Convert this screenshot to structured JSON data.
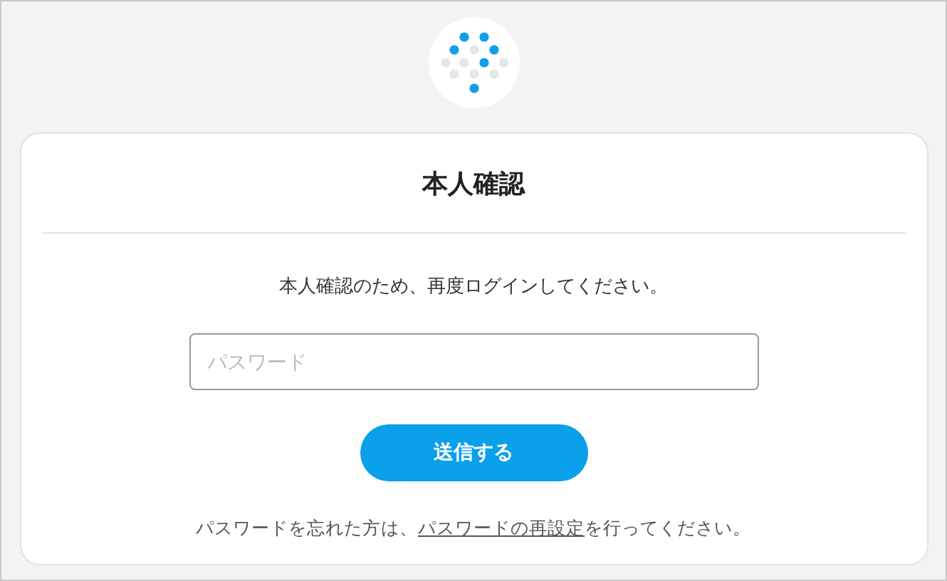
{
  "title": "本人確認",
  "message": "本人確認のため、再度ログインしてください。",
  "password_field": {
    "placeholder": "パスワード"
  },
  "submit_button": "送信する",
  "footer": {
    "before": "パスワードを忘れた方は、",
    "link": "パスワードの再設定",
    "after": "を行ってください。"
  }
}
